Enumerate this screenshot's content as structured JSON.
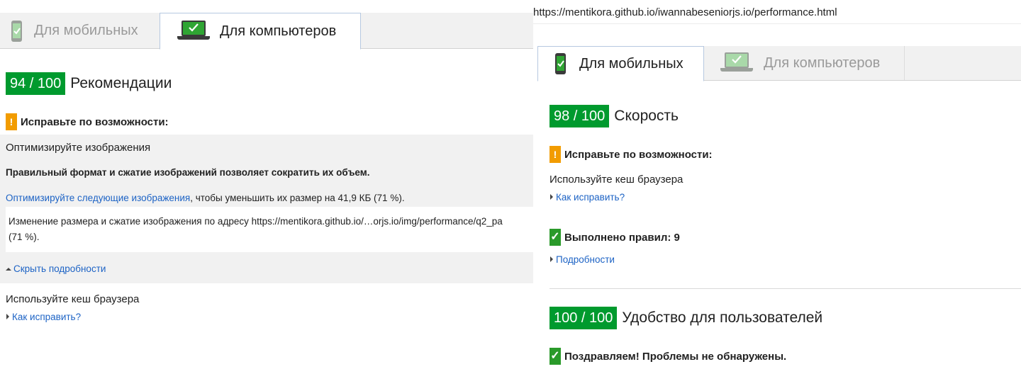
{
  "left": {
    "tabs": {
      "mobile": "Для мобильных",
      "desktop": "Для компьютеров"
    },
    "score": "94 / 100",
    "score_title": "Рекомендации",
    "warning": "Исправьте по возможности:",
    "optimize": {
      "title": "Оптимизируйте изображения",
      "bold": "Правильный формат и сжатие изображений позволяет сократить их объем.",
      "link": "Оптимизируйте следующие изображения",
      "link_rest": ", чтобы уменьшить их размер на 41,9 КБ (71 %).",
      "detail_line1": "Изменение размера и сжатие изображения по адресу https://mentikora.github.io/…orjs.io/img/performance/q2_pa",
      "detail_line2": "(71 %).",
      "hide": "Скрыть подробности"
    },
    "cache": {
      "title": "Используйте кеш браузера",
      "how": "Как исправить?"
    }
  },
  "right": {
    "url": "https://mentikora.github.io/iwannabeseniorjs.io/performance.html",
    "tabs": {
      "mobile": "Для мобильных",
      "desktop": "Для компьютеров"
    },
    "speed": {
      "score": "98 / 100",
      "title": "Скорость"
    },
    "warning": "Исправьте по возможности:",
    "cache": {
      "title": "Используйте кеш браузера",
      "how": "Как исправить?"
    },
    "passed": "Выполнено правил: 9",
    "details": "Подробности",
    "ux": {
      "score": "100 / 100",
      "title": "Удобство для пользователей"
    },
    "congrats": "Поздравляем! Проблемы не обнаружены."
  },
  "colors": {
    "badge": "#009a2e",
    "warn": "#f29c00",
    "ok": "#2a9a2a",
    "link": "#1d63c5"
  },
  "icons": {
    "mobile": "smartphone-check-icon",
    "desktop": "laptop-check-icon",
    "warn": "exclamation-icon",
    "ok": "checkmark-icon",
    "expand": "triangle-right-icon",
    "collapse": "triangle-up-icon"
  }
}
